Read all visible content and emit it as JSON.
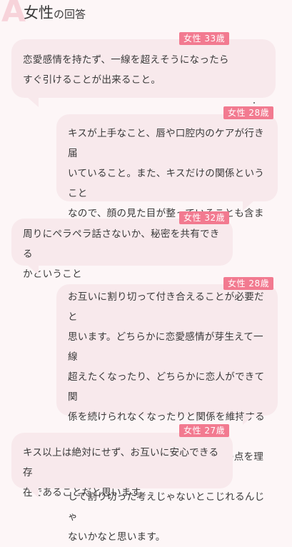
{
  "header": {
    "mark": "A",
    "title": "女性",
    "title_suffix": "の回答"
  },
  "answers": [
    {
      "badge": "女性 33歳",
      "text": "恋愛感情を持たず、一線を超えそうになったら\nすぐ引けることが出来ること。"
    },
    {
      "badge": "女性 28歳",
      "text": "キスが上手なこと、唇や口腔内のケアが行き届\nいていること。また、キスだけの関係ということ\nなので、顔の見た目が整っていることも含まれる\nと思います。"
    },
    {
      "badge": "女性 32歳",
      "text": "周りにペラペラ話さないか、秘密を共有できる\nかということ"
    },
    {
      "badge": "女性 28歳",
      "text": "お互いに割り切って付き合えることが必要だと\n思います。どちらかに恋愛感情が芽生えて一線\n超えたくなったり、どちらかに恋人ができて関\n係を続けられなくなったりと関係を維持するの\nがキスフレは難しいと思います。その点を理解\nして割り切った考えじゃないとこじれるんじゃ\nないかなと思います。"
    },
    {
      "badge": "女性 27歳",
      "text": "キス以上は絶対にせず、お互いに安心できる存\n在であることだと思います"
    }
  ]
}
